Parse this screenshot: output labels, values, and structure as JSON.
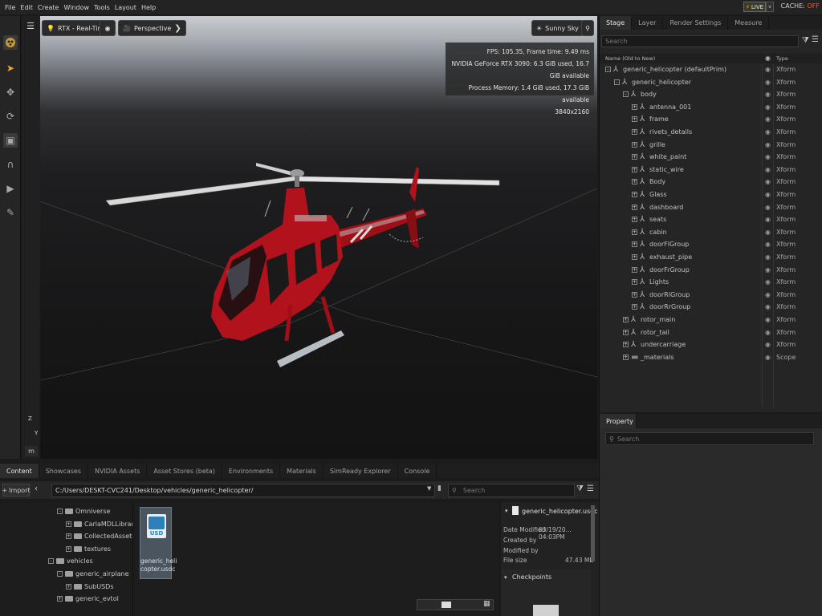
{
  "menu": [
    "File",
    "Edit",
    "Create",
    "Window",
    "Tools",
    "Layout",
    "Help"
  ],
  "live": {
    "label": "LIVE",
    "caret": "v"
  },
  "cache": {
    "label": "CACHE:",
    "state": "OFF"
  },
  "left_toolbar": [
    "omniverse-logo-icon",
    "select-arrow-icon",
    "move-icon",
    "rotate-icon",
    "scale-icon",
    "snap-magnet-icon",
    "play-icon",
    "paint-brush-icon"
  ],
  "viewport": {
    "render_mode": "RTX - Real-Time",
    "camera": "Perspective",
    "lighting": "Sunny Sky",
    "hud": {
      "fps": "FPS: 105.35, Frame time: 9.49 ms",
      "gpu": "NVIDIA GeForce RTX 3090: 6.3 GiB used, 16.7 GiB available",
      "memory": "Process Memory: 1.4 GiB used, 17.3 GiB available",
      "resolution": "3840x2160"
    },
    "axis_unit": "m",
    "axis_z": "Z",
    "axis_y": "Y",
    "accent_color": "#b1121b"
  },
  "stage": {
    "tabs": [
      "Stage",
      "Layer",
      "Render Settings",
      "Measure"
    ],
    "active_tab": "Stage",
    "search_placeholder": "Search",
    "columns": {
      "name": "Name (Old to New)",
      "type": "Type"
    },
    "tree": [
      {
        "name": "generic_helicopter (defaultPrim)",
        "type": "Xform",
        "depth": 0,
        "expander": "-",
        "icon": "xform"
      },
      {
        "name": "generic_helicopter",
        "type": "Xform",
        "depth": 1,
        "expander": "-",
        "icon": "xform"
      },
      {
        "name": "body",
        "type": "Xform",
        "depth": 2,
        "expander": "-",
        "icon": "xform"
      },
      {
        "name": "antenna_001",
        "type": "Xform",
        "depth": 3,
        "expander": "+",
        "icon": "xform"
      },
      {
        "name": "frame",
        "type": "Xform",
        "depth": 3,
        "expander": "+",
        "icon": "xform"
      },
      {
        "name": "rivets_details",
        "type": "Xform",
        "depth": 3,
        "expander": "+",
        "icon": "xform"
      },
      {
        "name": "grille",
        "type": "Xform",
        "depth": 3,
        "expander": "+",
        "icon": "xform"
      },
      {
        "name": "white_paint",
        "type": "Xform",
        "depth": 3,
        "expander": "+",
        "icon": "xform"
      },
      {
        "name": "static_wire",
        "type": "Xform",
        "depth": 3,
        "expander": "+",
        "icon": "xform"
      },
      {
        "name": "Body",
        "type": "Xform",
        "depth": 3,
        "expander": "+",
        "icon": "xform"
      },
      {
        "name": "Glass",
        "type": "Xform",
        "depth": 3,
        "expander": "+",
        "icon": "xform"
      },
      {
        "name": "dashboard",
        "type": "Xform",
        "depth": 3,
        "expander": "+",
        "icon": "xform"
      },
      {
        "name": "seats",
        "type": "Xform",
        "depth": 3,
        "expander": "+",
        "icon": "xform"
      },
      {
        "name": "cabin",
        "type": "Xform",
        "depth": 3,
        "expander": "+",
        "icon": "xform"
      },
      {
        "name": "doorFlGroup",
        "type": "Xform",
        "depth": 3,
        "expander": "+",
        "icon": "xform"
      },
      {
        "name": "exhaust_pipe",
        "type": "Xform",
        "depth": 3,
        "expander": "+",
        "icon": "xform"
      },
      {
        "name": "doorFrGroup",
        "type": "Xform",
        "depth": 3,
        "expander": "+",
        "icon": "xform"
      },
      {
        "name": "Lights",
        "type": "Xform",
        "depth": 3,
        "expander": "+",
        "icon": "xform"
      },
      {
        "name": "doorRlGroup",
        "type": "Xform",
        "depth": 3,
        "expander": "+",
        "icon": "xform"
      },
      {
        "name": "doorRrGroup",
        "type": "Xform",
        "depth": 3,
        "expander": "+",
        "icon": "xform"
      },
      {
        "name": "rotor_main",
        "type": "Xform",
        "depth": 2,
        "expander": "+",
        "icon": "xform"
      },
      {
        "name": "rotor_tail",
        "type": "Xform",
        "depth": 2,
        "expander": "+",
        "icon": "xform"
      },
      {
        "name": "undercarriage",
        "type": "Xform",
        "depth": 2,
        "expander": "+",
        "icon": "xform"
      },
      {
        "name": "_materials",
        "type": "Scope",
        "depth": 2,
        "expander": "+",
        "icon": "folder"
      }
    ]
  },
  "property": {
    "tab": "Property",
    "search_placeholder": "Search"
  },
  "content": {
    "tabs": [
      "Content",
      "Showcases",
      "NVIDIA Assets",
      "Asset Stores (beta)",
      "Environments",
      "Materials",
      "SimReady Explorer",
      "Console"
    ],
    "active_tab": "Content",
    "import_label": "Import",
    "path": "C:/Users/DESKT-CVC241/Desktop/vehicles/generic_helicopter/",
    "search_placeholder": "Search",
    "folders": [
      {
        "name": "Omniverse",
        "depth": 1,
        "expander": "-"
      },
      {
        "name": "CarlaMDLLibrary",
        "depth": 2,
        "expander": "+"
      },
      {
        "name": "CollectedAssets",
        "depth": 2,
        "expander": "+"
      },
      {
        "name": "textures",
        "depth": 2,
        "expander": "+"
      },
      {
        "name": "vehicles",
        "depth": 0,
        "expander": "-"
      },
      {
        "name": "generic_airplane",
        "depth": 1,
        "expander": "-"
      },
      {
        "name": "SubUSDs",
        "depth": 2,
        "expander": "+"
      },
      {
        "name": "generic_evtol",
        "depth": 1,
        "expander": "+"
      }
    ],
    "file": {
      "name_line1": "generic_heli",
      "name_line2": "copter.usdc",
      "badge": "USD"
    },
    "details": {
      "filename": "generic_helicopter.usdc",
      "date_modified_label": "Date Modified",
      "date_modified": "03/19/20... 04:03PM",
      "created_by_label": "Created by",
      "modified_by_label": "Modified by",
      "file_size_label": "File size",
      "file_size": "47.43 MB",
      "checkpoints_label": "Checkpoints"
    }
  }
}
